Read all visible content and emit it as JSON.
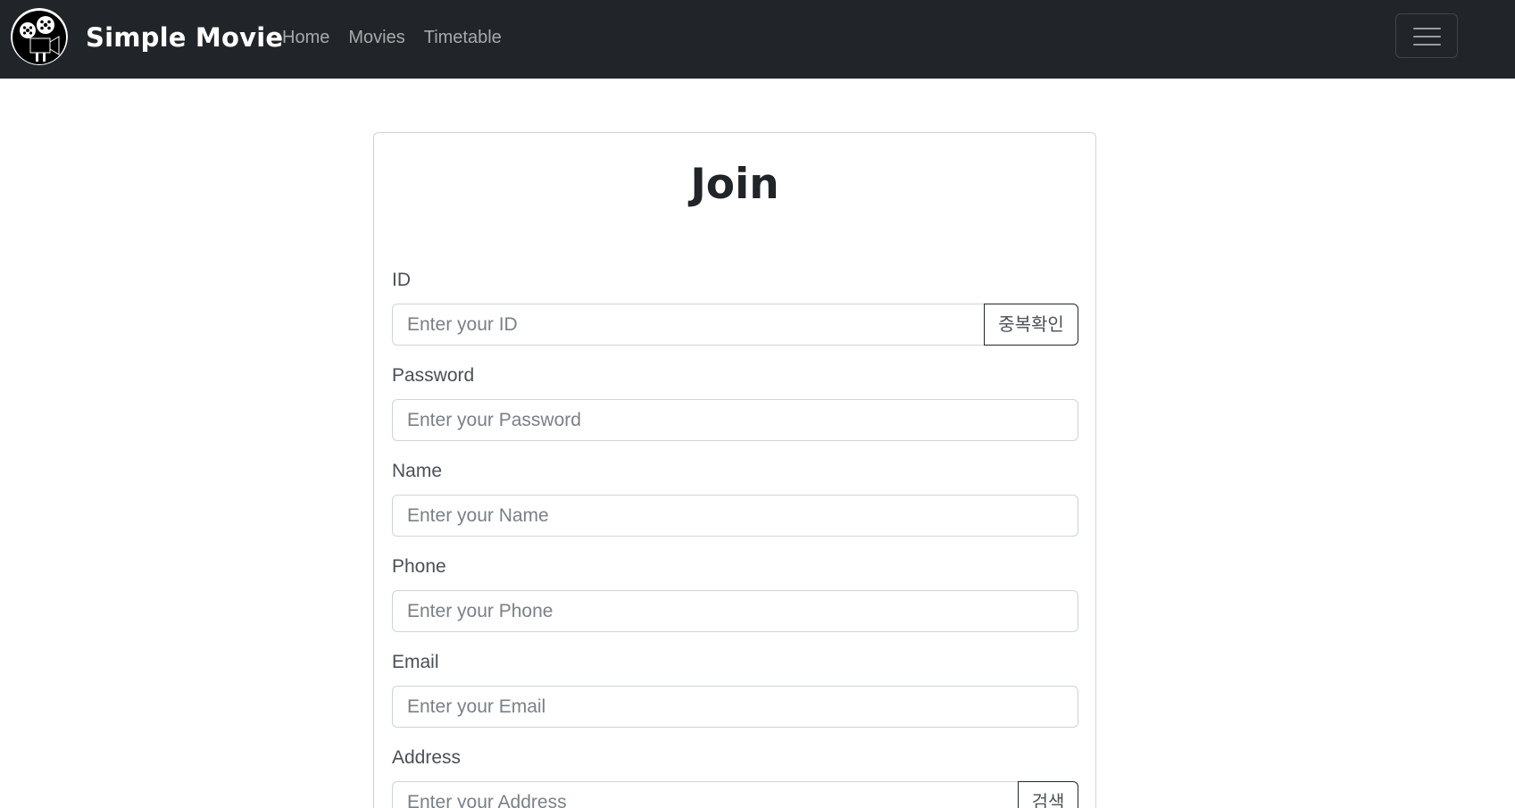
{
  "navbar": {
    "brand": "Simple Movie",
    "links": [
      "Home",
      "Movies",
      "Timetable"
    ]
  },
  "form": {
    "title": "Join",
    "id": {
      "label": "ID",
      "placeholder": "Enter your ID",
      "button": "중복확인"
    },
    "password": {
      "label": "Password",
      "placeholder": "Enter your Password"
    },
    "name": {
      "label": "Name",
      "placeholder": "Enter your Name"
    },
    "phone": {
      "label": "Phone",
      "placeholder": "Enter your Phone"
    },
    "email": {
      "label": "Email",
      "placeholder": "Enter your Email"
    },
    "address": {
      "label": "Address",
      "placeholder": "Enter your Address",
      "button": "검색"
    }
  },
  "colors": {
    "navbar_bg": "#212529",
    "brand": "#ffffff",
    "nav_link": "rgba(255,255,255,0.6)",
    "input_border": "#ced4da",
    "label": "#495057"
  },
  "icons": [
    "film-reel-logo-icon",
    "hamburger-menu-icon"
  ]
}
